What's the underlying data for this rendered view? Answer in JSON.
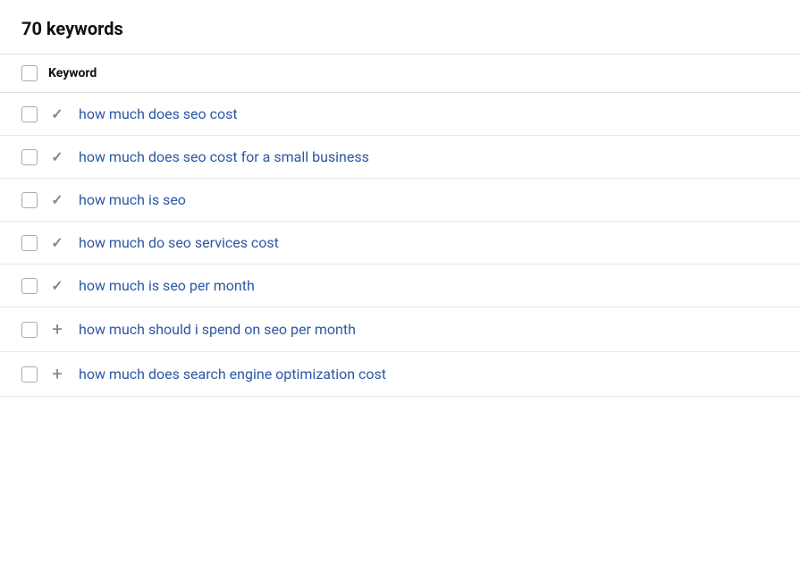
{
  "header": {
    "title": "70 keywords"
  },
  "table": {
    "column_label": "Keyword",
    "rows": [
      {
        "id": 1,
        "keyword": "how much does seo cost",
        "icon_type": "check"
      },
      {
        "id": 2,
        "keyword": "how much does seo cost for a small business",
        "icon_type": "check"
      },
      {
        "id": 3,
        "keyword": "how much is seo",
        "icon_type": "check"
      },
      {
        "id": 4,
        "keyword": "how much do seo services cost",
        "icon_type": "check"
      },
      {
        "id": 5,
        "keyword": "how much is seo per month",
        "icon_type": "check"
      },
      {
        "id": 6,
        "keyword": "how much should i spend on seo per month",
        "icon_type": "plus"
      },
      {
        "id": 7,
        "keyword": "how much does search engine optimization cost",
        "icon_type": "plus"
      }
    ]
  }
}
